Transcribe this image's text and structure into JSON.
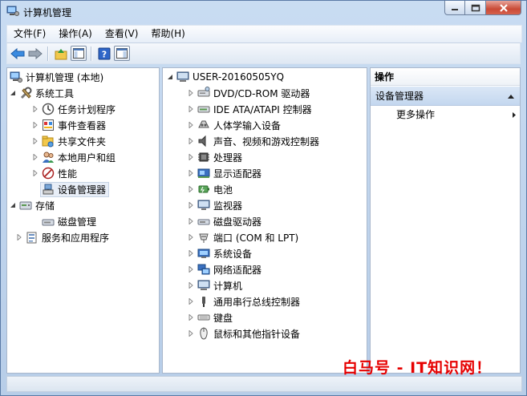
{
  "window": {
    "title": "计算机管理"
  },
  "menu": [
    "文件(F)",
    "操作(A)",
    "查看(V)",
    "帮助(H)"
  ],
  "tree": {
    "root": "计算机管理 (本地)",
    "system_tools": "系统工具",
    "items": [
      "任务计划程序",
      "事件查看器",
      "共享文件夹",
      "本地用户和组",
      "性能",
      "设备管理器"
    ],
    "storage": "存储",
    "disk_mgmt": "磁盘管理",
    "services": "服务和应用程序"
  },
  "devices": {
    "root": "USER-20160505YQ",
    "items": [
      "DVD/CD-ROM 驱动器",
      "IDE ATA/ATAPI 控制器",
      "人体学输入设备",
      "声音、视频和游戏控制器",
      "处理器",
      "显示适配器",
      "电池",
      "监视器",
      "磁盘驱动器",
      "端口 (COM 和 LPT)",
      "系统设备",
      "网络适配器",
      "计算机",
      "通用串行总线控制器",
      "键盘",
      "鼠标和其他指针设备"
    ],
    "icons": [
      "dvd-drive-icon",
      "ide-controller-icon",
      "hid-icon",
      "sound-icon",
      "processor-icon",
      "display-adapter-icon",
      "battery-icon",
      "monitor-icon",
      "disk-drive-icon",
      "port-icon",
      "system-device-icon",
      "network-adapter-icon",
      "computer-icon",
      "usb-controller-icon",
      "keyboard-icon",
      "mouse-icon"
    ]
  },
  "actions": {
    "header": "操作",
    "section": "设备管理器",
    "more": "更多操作"
  },
  "watermark": "白马号 - IT知识网！",
  "colors": {
    "selection": "#c4d7ef",
    "accent": "#e60000"
  }
}
